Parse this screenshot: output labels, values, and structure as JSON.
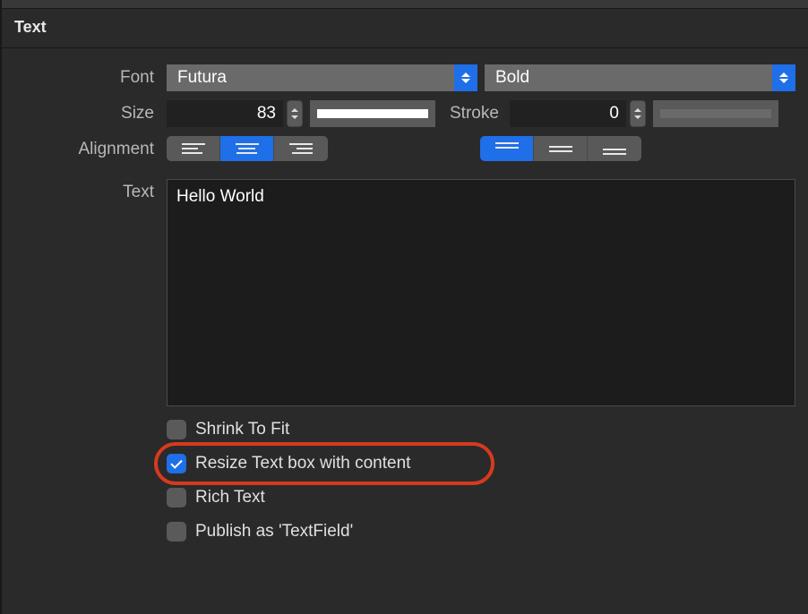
{
  "section_title": "Text",
  "labels": {
    "font": "Font",
    "size": "Size",
    "stroke": "Stroke",
    "alignment": "Alignment",
    "text": "Text"
  },
  "font": {
    "family": "Futura",
    "weight": "Bold"
  },
  "size": {
    "value": "83"
  },
  "fill_color": "#ffffff",
  "stroke": {
    "value": "0"
  },
  "stroke_color": "#6a6a6a",
  "text_content": "Hello World",
  "checkboxes": {
    "shrink": {
      "label": "Shrink To Fit",
      "checked": false
    },
    "resize": {
      "label": "Resize Text box with content",
      "checked": true
    },
    "rich": {
      "label": "Rich Text",
      "checked": false
    },
    "publish": {
      "label": "Publish as 'TextField'",
      "checked": false
    }
  },
  "alignment": {
    "horizontal": "center",
    "vertical": "top"
  }
}
